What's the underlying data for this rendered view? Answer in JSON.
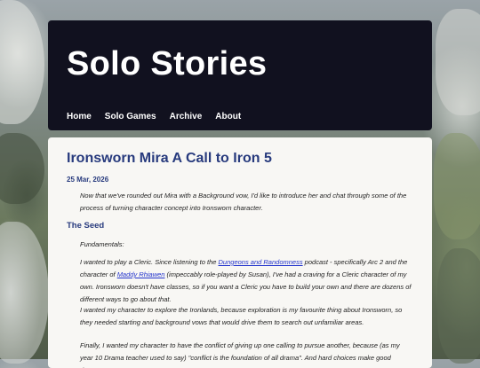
{
  "site": {
    "title": "Solo Stories",
    "nav": [
      "Home",
      "Solo Games",
      "Archive",
      "About"
    ]
  },
  "post": {
    "title": "Ironsworn Mira A Call to Iron 5",
    "date": "25 Mar, 2026",
    "intro": "Now that we've rounded out Mira with a Background vow, I'd like to introduce her and chat through some of the process of turning character concept into Ironsworn character.",
    "section_heading": "The Seed",
    "fundamentals": "Fundamentals:",
    "p_cleric": {
      "before_link1": "I wanted to play a Cleric. Since listening to the ",
      "link1": "Dungeons and Randomness",
      "between_links": " podcast - specifically Arc 2 and the character of ",
      "link2": "Maddy Rhiawen",
      "after_link2": " (impeccably role-played by Susan), I've had a craving for a Cleric character of my own. Ironsworn doesn't have classes, so if you want a Cleric you have to build your own and there are dozens of different ways to go about that."
    },
    "p_explore": "I wanted my character to explore the Ironlands, because exploration is my favourite thing about Ironsworn, so they needed starting and background vows that would drive them to search out unfamiliar areas.",
    "p_conflict": "Finally, I wanted my character to have the conflict of giving up one calling to pursue another, because (as my year 10 Drama teacher used to say) \"conflict is the foundation of all drama\". And hard choices make good drama."
  }
}
